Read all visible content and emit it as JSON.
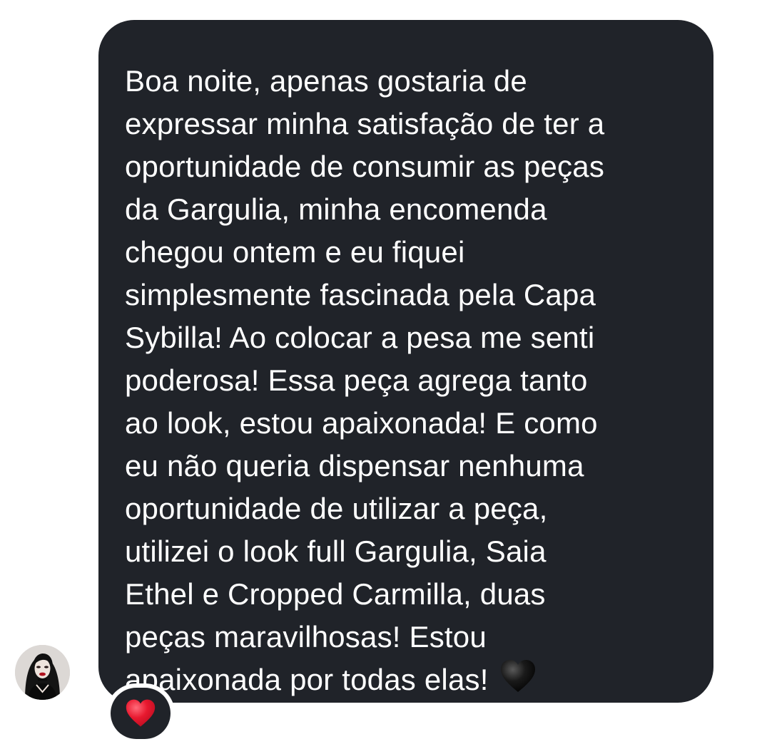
{
  "message": {
    "text": "Boa noite, apenas gostaria de\nexpressar minha satisfação de ter a\noportunidade de consumir as peças\nda Gargulia, minha encomenda\nchegou ontem e eu fiquei\nsimplesmente fascinada pela Capa\nSybilla! Ao colocar a pesa me senti\npoderosa! Essa peça agrega tanto\nao look, estou apaixonada! E como\neu não queria dispensar nenhuma\noportunidade de utilizar a peça,\nutilizei o look full Gargulia, Saia\nEthel e Cropped Carmilla, duas\npeças maravilhosas! Estou\napaixonada por todas elas!",
    "trailing_emoji": "black-heart-icon",
    "bubble_color": "#202329",
    "text_color": "#ffffff"
  },
  "reaction": {
    "emoji": "red-heart-icon",
    "color": "#e0142b"
  },
  "sender": {
    "avatar": "profile-avatar"
  }
}
